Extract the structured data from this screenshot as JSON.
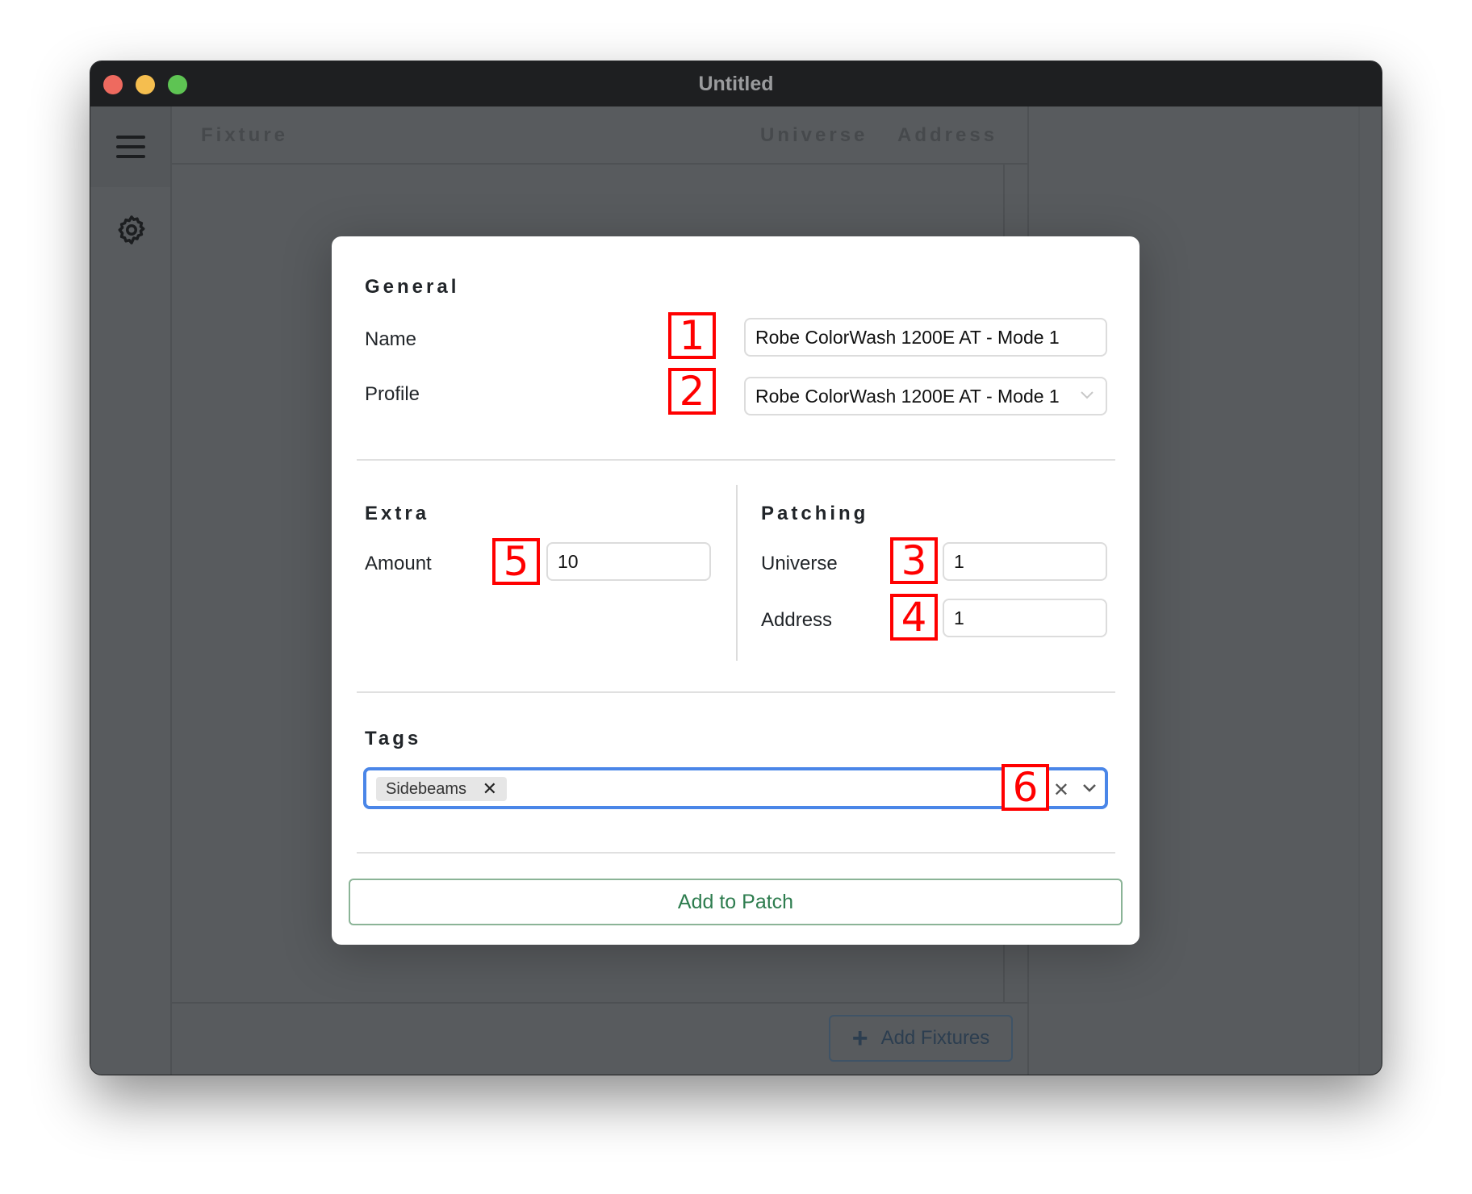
{
  "window": {
    "title": "Untitled",
    "traffic_lights": [
      "close",
      "minimize",
      "zoom"
    ]
  },
  "sidebar": {
    "items": [
      {
        "icon": "hamburger-menu-icon"
      },
      {
        "icon": "gear-icon"
      }
    ]
  },
  "table": {
    "columns": [
      "Fixture",
      "Universe",
      "Address"
    ],
    "rows": [],
    "footer_button": {
      "icon": "plus-icon",
      "label": "Add Fixtures"
    }
  },
  "modal": {
    "general": {
      "title": "General",
      "name_label": "Name",
      "name_value": "Robe ColorWash 1200E AT - Mode 1",
      "profile_label": "Profile",
      "profile_value": "Robe ColorWash 1200E AT - Mode 1"
    },
    "extra": {
      "title": "Extra",
      "amount_label": "Amount",
      "amount_value": "10"
    },
    "patching": {
      "title": "Patching",
      "universe_label": "Universe",
      "universe_value": "1",
      "address_label": "Address",
      "address_value": "1"
    },
    "tags": {
      "title": "Tags",
      "chips": [
        "Sidebeams"
      ],
      "chip_remove": "✕",
      "clear": "✕"
    },
    "submit_label": "Add to Patch"
  },
  "annotations": [
    "1",
    "2",
    "3",
    "4",
    "5",
    "6"
  ],
  "colors": {
    "accent_focus": "#4a86e8",
    "submit_green": "#2e7d4f",
    "annotation_red": "#ff0000"
  }
}
